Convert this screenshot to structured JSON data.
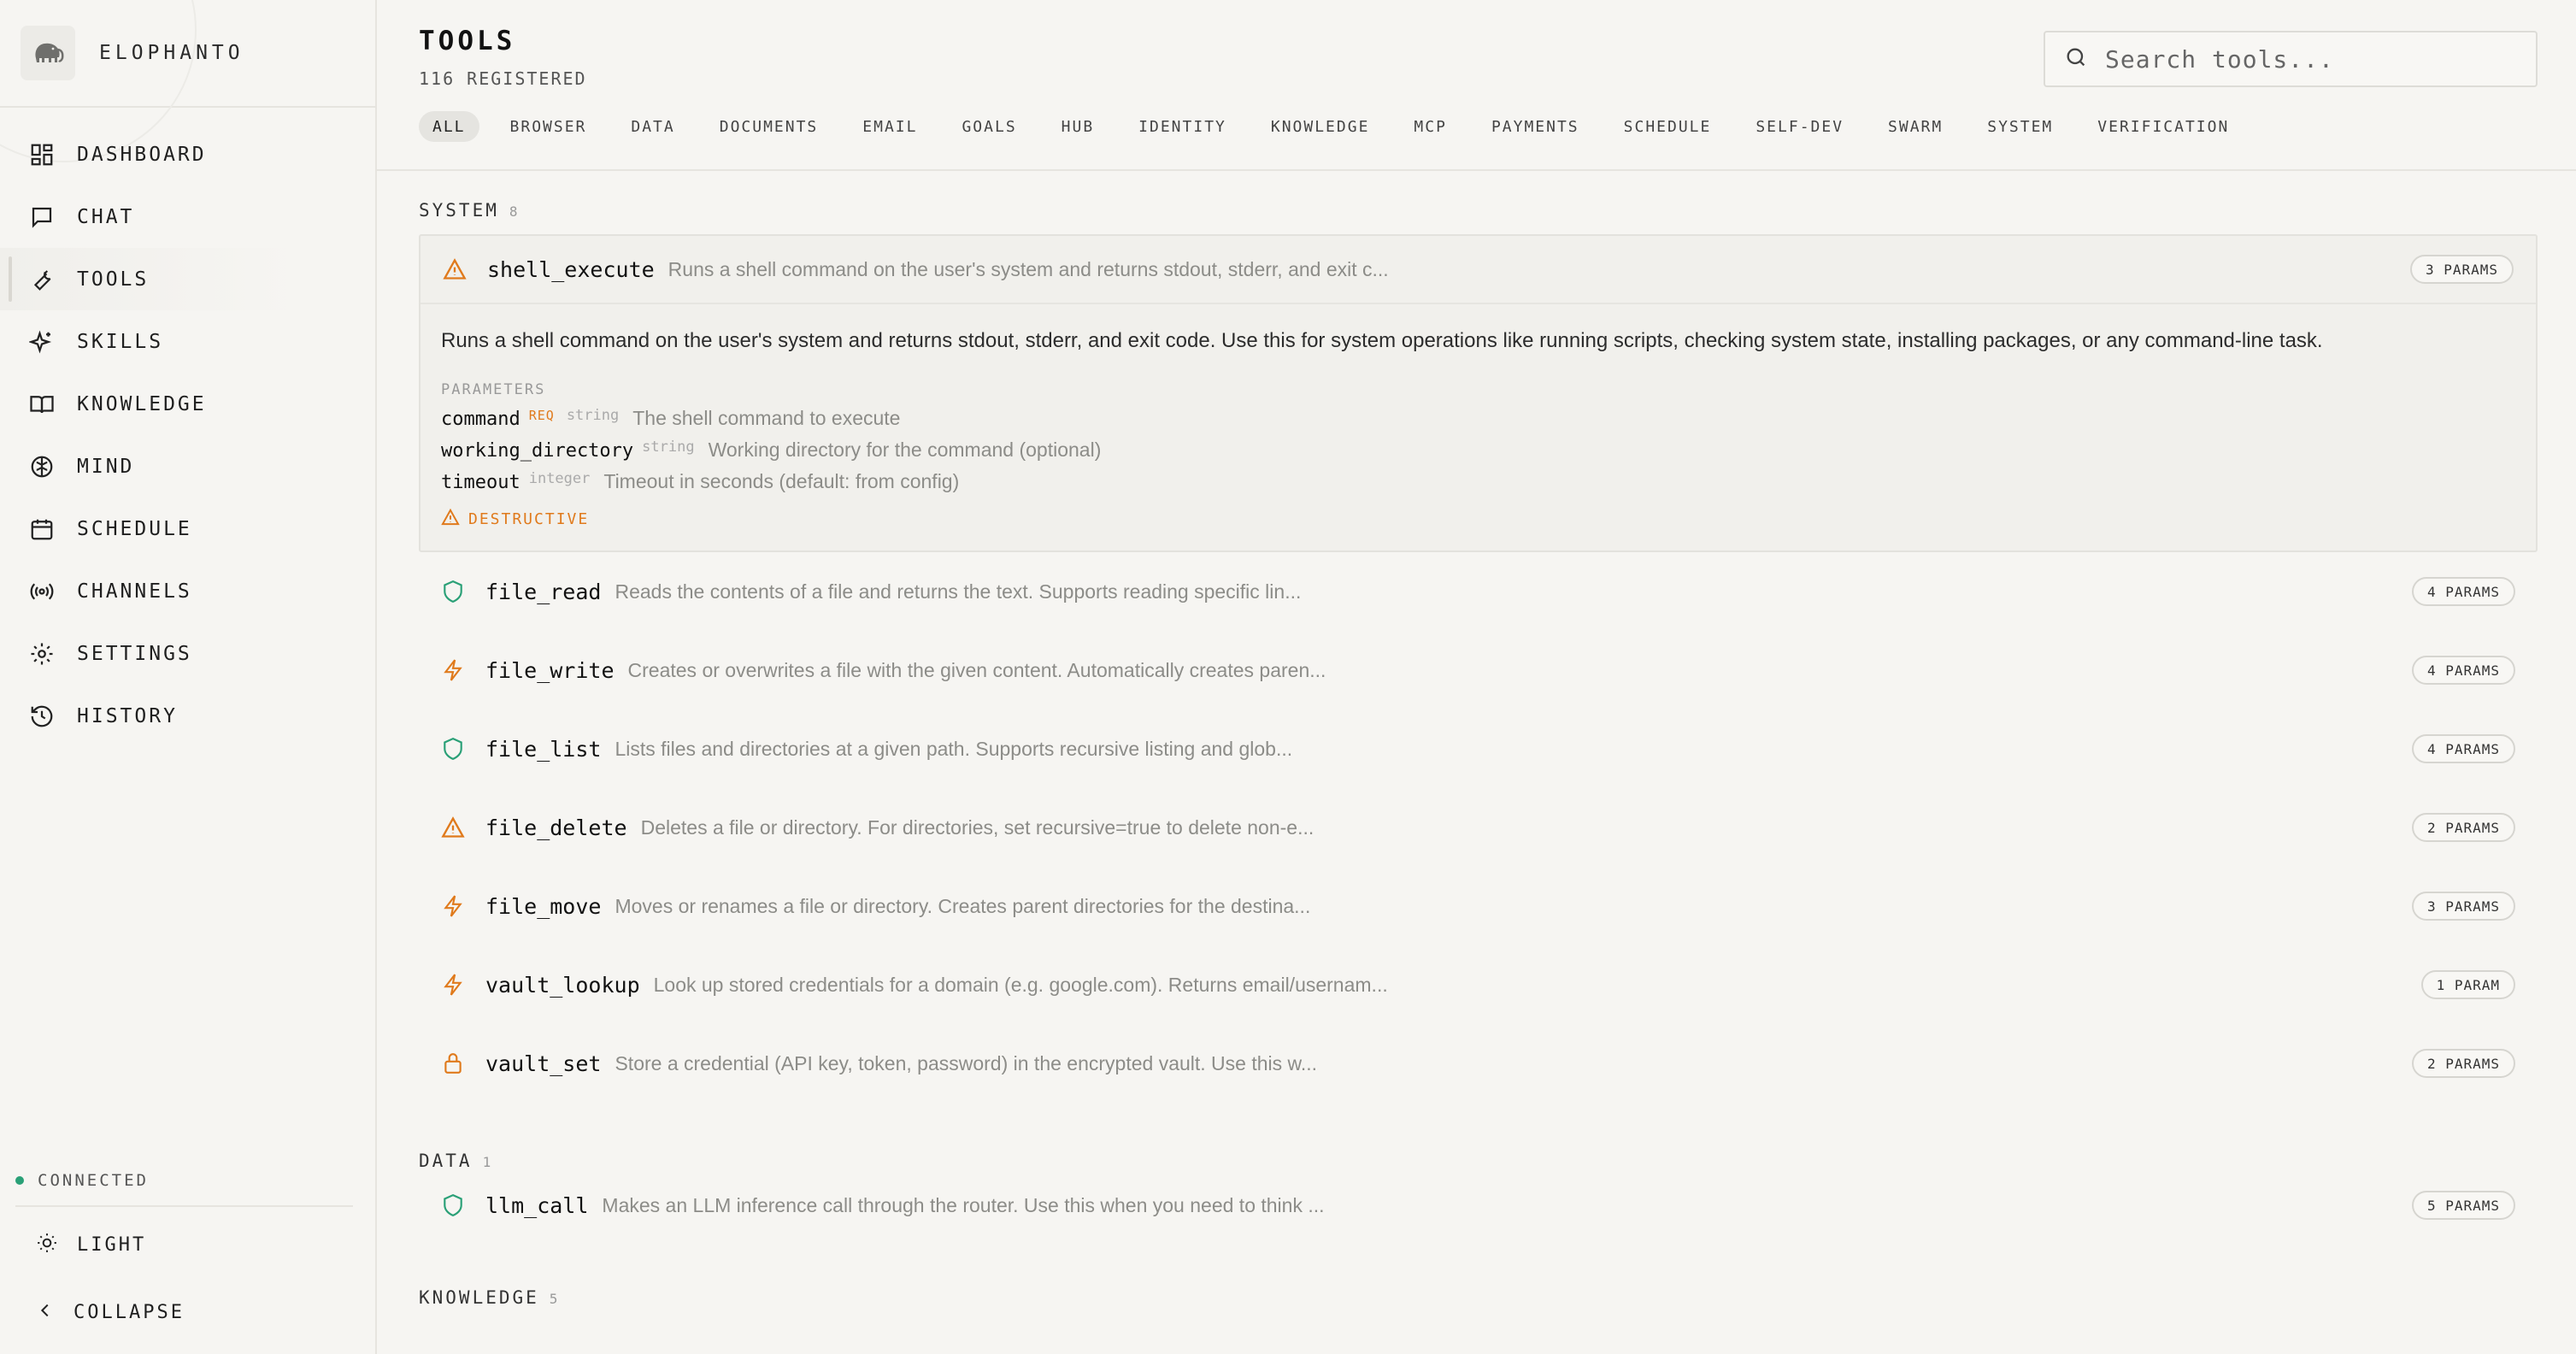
{
  "app": {
    "name": "ELOPHANTO"
  },
  "sidebar": {
    "items": [
      {
        "label": "DASHBOARD",
        "icon": "dashboard-icon"
      },
      {
        "label": "CHAT",
        "icon": "chat-icon"
      },
      {
        "label": "TOOLS",
        "icon": "wrench-icon",
        "active": true
      },
      {
        "label": "SKILLS",
        "icon": "sparkles-icon"
      },
      {
        "label": "KNOWLEDGE",
        "icon": "book-icon"
      },
      {
        "label": "MIND",
        "icon": "brain-icon"
      },
      {
        "label": "SCHEDULE",
        "icon": "calendar-icon"
      },
      {
        "label": "CHANNELS",
        "icon": "broadcast-icon"
      },
      {
        "label": "SETTINGS",
        "icon": "gear-icon"
      },
      {
        "label": "HISTORY",
        "icon": "history-icon"
      }
    ],
    "status": "CONNECTED",
    "theme_label": "LIGHT",
    "collapse_label": "COLLAPSE"
  },
  "header": {
    "title": "TOOLS",
    "subtitle": "116 REGISTERED",
    "search_placeholder": "Search tools..."
  },
  "tabs": [
    "ALL",
    "BROWSER",
    "DATA",
    "DOCUMENTS",
    "EMAIL",
    "GOALS",
    "HUB",
    "IDENTITY",
    "KNOWLEDGE",
    "MCP",
    "PAYMENTS",
    "SCHEDULE",
    "SELF-DEV",
    "SWARM",
    "SYSTEM",
    "VERIFICATION"
  ],
  "sections": {
    "system": {
      "title": "SYSTEM",
      "count": "8",
      "expanded": {
        "name": "shell_execute",
        "desc": "Runs a shell command on the user's system and returns stdout, stderr, and exit c...",
        "badge": "3 PARAMS",
        "full_desc": "Runs a shell command on the user's system and returns stdout, stderr, and exit code. Use this for system operations like running scripts, checking system state, installing packages, or any command-line task.",
        "params_label": "PARAMETERS",
        "params": [
          {
            "name": "command",
            "req": "REQ",
            "type": "string",
            "desc": "The shell command to execute"
          },
          {
            "name": "working_directory",
            "req": "",
            "type": "string",
            "desc": "Working directory for the command (optional)"
          },
          {
            "name": "timeout",
            "req": "",
            "type": "integer",
            "desc": "Timeout in seconds (default: from config)"
          }
        ],
        "flag": "DESTRUCTIVE"
      },
      "tools": [
        {
          "name": "file_read",
          "icon": "shield-icon",
          "desc": "Reads the contents of a file and returns the text. Supports reading specific lin...",
          "badge": "4 PARAMS"
        },
        {
          "name": "file_write",
          "icon": "bolt-icon",
          "desc": "Creates or overwrites a file with the given content. Automatically creates paren...",
          "badge": "4 PARAMS"
        },
        {
          "name": "file_list",
          "icon": "shield-icon",
          "desc": "Lists files and directories at a given path. Supports recursive listing and glob...",
          "badge": "4 PARAMS"
        },
        {
          "name": "file_delete",
          "icon": "warning-icon",
          "desc": "Deletes a file or directory. For directories, set recursive=true to delete non-e...",
          "badge": "2 PARAMS"
        },
        {
          "name": "file_move",
          "icon": "bolt-icon",
          "desc": "Moves or renames a file or directory. Creates parent directories for the destina...",
          "badge": "3 PARAMS"
        },
        {
          "name": "vault_lookup",
          "icon": "bolt-icon",
          "desc": "Look up stored credentials for a domain (e.g. google.com). Returns email/usernam...",
          "badge": "1 PARAM"
        },
        {
          "name": "vault_set",
          "icon": "lock-icon",
          "desc": "Store a credential (API key, token, password) in the encrypted vault. Use this w...",
          "badge": "2 PARAMS"
        }
      ]
    },
    "data": {
      "title": "DATA",
      "count": "1",
      "tools": [
        {
          "name": "llm_call",
          "icon": "shield-icon",
          "desc": "Makes an LLM inference call through the router. Use this when you need to think ...",
          "badge": "5 PARAMS"
        }
      ]
    },
    "knowledge": {
      "title": "KNOWLEDGE",
      "count": "5"
    }
  },
  "colors": {
    "accent": "#e07a1c",
    "safe": "#2aa077",
    "background": "#f6f5f2"
  }
}
